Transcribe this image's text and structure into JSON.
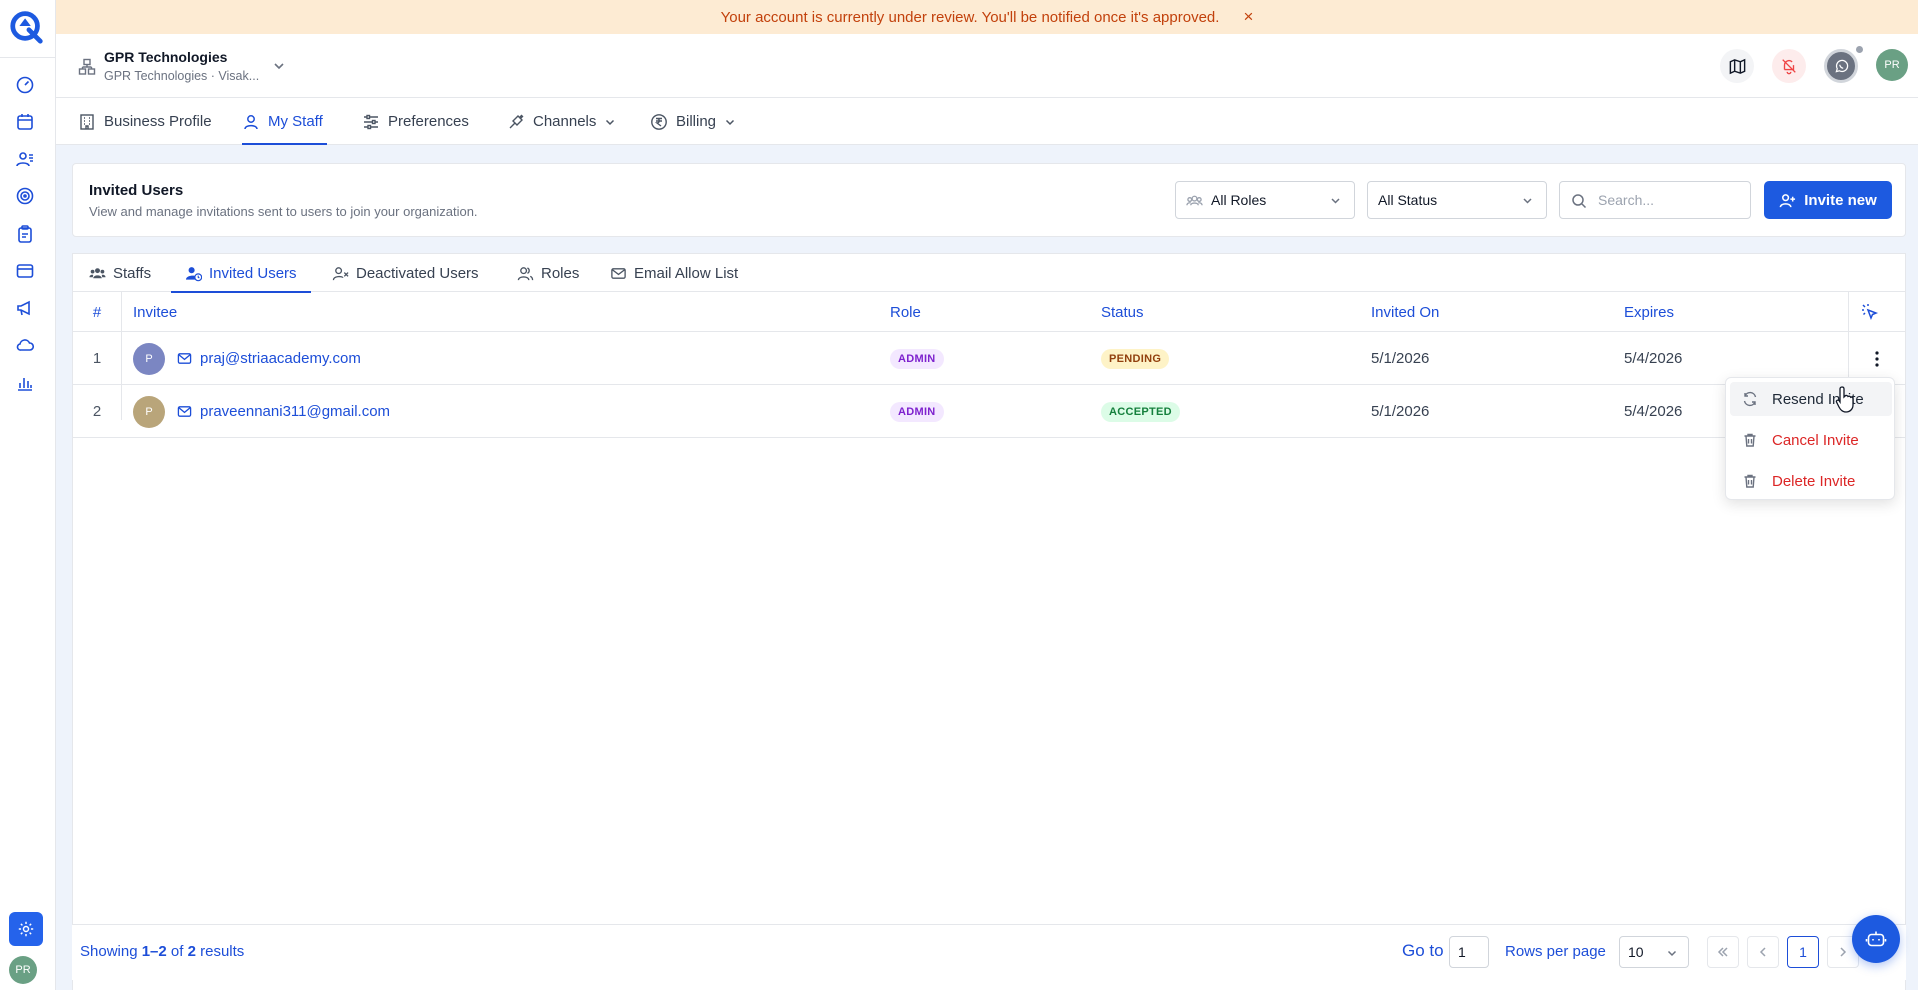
{
  "banner": {
    "message": "Your account is currently under review. You'll be notified once it's approved.",
    "close_label": "×"
  },
  "org": {
    "name": "GPR Technologies",
    "subtitle": "GPR Technologies · Visak..."
  },
  "user": {
    "initials": "PR"
  },
  "main_tabs": [
    {
      "label": "Business Profile",
      "icon": "building-icon"
    },
    {
      "label": "My Staff",
      "icon": "user-icon",
      "active": true
    },
    {
      "label": "Preferences",
      "icon": "sliders-icon"
    },
    {
      "label": "Channels",
      "icon": "plug-icon"
    },
    {
      "label": "Billing",
      "icon": "rupee-icon"
    }
  ],
  "panel_header": {
    "title": "Invited Users",
    "subtitle": "View and manage invitations sent to users to join your organization.",
    "roles_filter": "All Roles",
    "status_filter": "All Status",
    "search_placeholder": "Search...",
    "invite_label": "Invite new"
  },
  "sub_tabs": [
    {
      "label": "Staffs",
      "icon": "users-icon"
    },
    {
      "label": "Invited Users",
      "icon": "user-clock-icon",
      "active": true
    },
    {
      "label": "Deactivated Users",
      "icon": "user-x-icon"
    },
    {
      "label": "Roles",
      "icon": "people-icon"
    },
    {
      "label": "Email Allow List",
      "icon": "mail-icon"
    }
  ],
  "table": {
    "columns": [
      "#",
      "Invitee",
      "Role",
      "Status",
      "Invited On",
      "Expires"
    ],
    "rows": [
      {
        "index": "1",
        "avatar": "P",
        "avatar_color": "#7b86c2",
        "email": "praj@striaacademy.com",
        "role": "ADMIN",
        "status": "PENDING",
        "invited_on": "5/1/2026",
        "expires": "5/4/2026"
      },
      {
        "index": "2",
        "avatar": "P",
        "avatar_color": "#b9a57a",
        "email": "praveennani311@gmail.com",
        "role": "ADMIN",
        "status": "ACCEPTED",
        "invited_on": "5/1/2026",
        "expires": "5/4/2026"
      }
    ]
  },
  "row_menu": {
    "resend": "Resend Invite",
    "cancel": "Cancel Invite",
    "delete": "Delete Invite"
  },
  "footer": {
    "showing_prefix": "Showing",
    "showing_range": "1–2",
    "showing_of": "of",
    "showing_total": "2",
    "showing_suffix": "results",
    "goto_label": "Go to",
    "goto_value": "1",
    "rows_per_page_label": "Rows per page",
    "rows_per_page_value": "10",
    "current_page": "1"
  },
  "colors": {
    "accent": "#1d5ae0",
    "banner_bg": "#fdebd3",
    "banner_text": "#c2410c",
    "danger": "#dc2626"
  }
}
